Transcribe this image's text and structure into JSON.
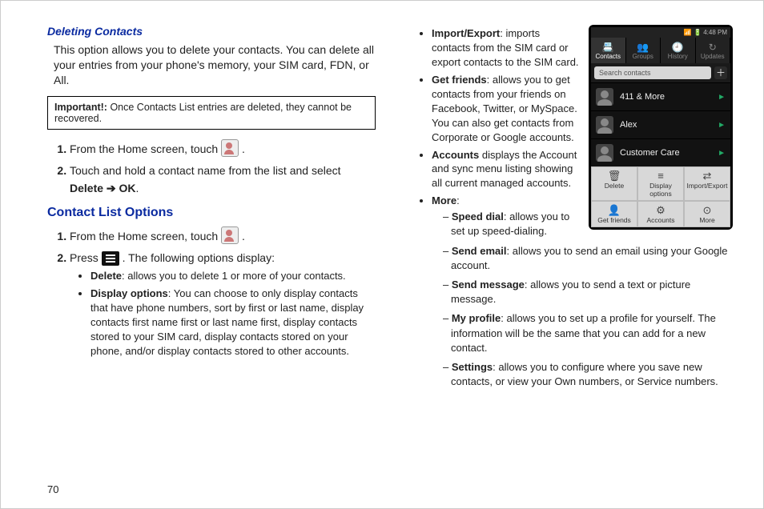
{
  "page_number": "70",
  "leftCol": {
    "deleting_heading": "Deleting Contacts",
    "deleting_body": "This option allows you to delete your contacts. You can delete all your entries from your phone's memory, your SIM card, FDN, or All.",
    "important_label": "Important!:",
    "important_text": " Once Contacts List entries are deleted, they cannot be recovered.",
    "step1_a": "From the Home screen, touch ",
    "step1_b": ".",
    "step2_a": "Touch and hold a contact name from the list and select ",
    "step2_bold": "Delete ",
    "step2_arrow": "➔ ",
    "step2_ok": "OK",
    "step2_end": ".",
    "clo_heading": "Contact List Options",
    "clo1_a": "From the Home screen, touch ",
    "clo1_b": ".",
    "clo2_a": "Press ",
    "clo2_b": ". The following options display:",
    "opt_delete_b": "Delete",
    "opt_delete_t": ": allows you to delete 1 or more of your contacts.",
    "opt_disp_b": "Display options",
    "opt_disp_t": ": You can choose to only display contacts that have phone numbers, sort by first or last name, display contacts first name first or last name first, display contacts stored to your SIM card, display contacts stored on your phone, and/or display contacts stored to other accounts."
  },
  "rightCol": {
    "opt_imp_b": "Import/Export",
    "opt_imp_t": ": imports contacts from the SIM card or export contacts to the SIM card.",
    "opt_get_b": "Get friends",
    "opt_get_t": ": allows you to get contacts from your friends on Facebook, Twitter, or MySpace. You can also get contacts from Corporate or Google accounts.",
    "opt_acc_b": "Accounts",
    "opt_acc_t": " displays the Account and sync menu listing showing all current managed accounts.",
    "opt_more_b": "More",
    "opt_more_t": ":",
    "more": [
      {
        "b": "Speed dial",
        "t": ": allows you to set up speed-dialing."
      },
      {
        "b": "Send email",
        "t": ": allows you to send an email using your Google account."
      },
      {
        "b": "Send message",
        "t": ": allows you to send a text or picture message."
      },
      {
        "b": "My profile",
        "t": ": allows you to set up a profile for yourself. The information will be the same that you can add for a new contact."
      },
      {
        "b": "Settings",
        "t": ": allows you to configure where you save new contacts, or view your Own numbers, or Service numbers."
      }
    ]
  },
  "phone": {
    "status_time": "4:48 PM",
    "tabs": [
      {
        "icon": "📇",
        "label": "Contacts"
      },
      {
        "icon": "👥",
        "label": "Groups"
      },
      {
        "icon": "🕘",
        "label": "History"
      },
      {
        "icon": "↻",
        "label": "Updates"
      }
    ],
    "search_placeholder": "Search contacts",
    "contacts": [
      "411 & More",
      "Alex",
      "Customer Care"
    ],
    "menu": [
      {
        "icon": "🗑",
        "label": "Delete"
      },
      {
        "icon": "≡",
        "label": "Display options"
      },
      {
        "icon": "⇄",
        "label": "Import/Export"
      },
      {
        "icon": "👤",
        "label": "Get friends"
      },
      {
        "icon": "⚙",
        "label": "Accounts"
      },
      {
        "icon": "⊙",
        "label": "More"
      }
    ]
  }
}
